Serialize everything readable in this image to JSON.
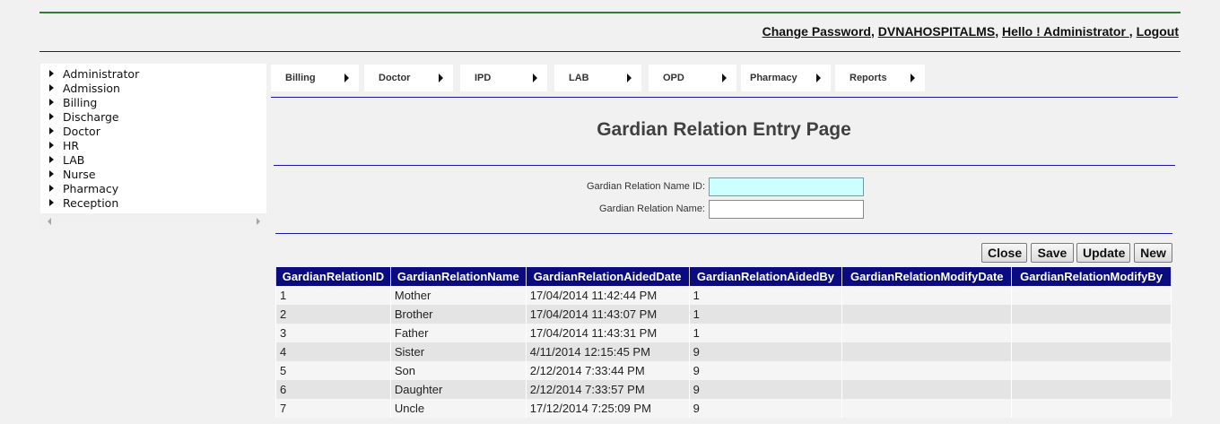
{
  "header": {
    "links": [
      {
        "label": "Change Password"
      },
      {
        "label": "DVNAHOSPITALMS"
      },
      {
        "label": "Hello ! Administrator "
      },
      {
        "label": "Logout"
      }
    ],
    "separator": ", "
  },
  "sidebar": {
    "items": [
      {
        "label": "Administrator"
      },
      {
        "label": "Admission"
      },
      {
        "label": "Billing"
      },
      {
        "label": "Discharge"
      },
      {
        "label": "Doctor"
      },
      {
        "label": "HR"
      },
      {
        "label": "LAB"
      },
      {
        "label": "Nurse"
      },
      {
        "label": "Pharmacy"
      },
      {
        "label": "Reception"
      }
    ]
  },
  "menu": {
    "items": [
      {
        "label": "Billing"
      },
      {
        "label": "Doctor"
      },
      {
        "label": "IPD"
      },
      {
        "label": "LAB"
      },
      {
        "label": "OPD"
      },
      {
        "label": "Pharmacy"
      },
      {
        "label": "Reports"
      }
    ]
  },
  "page": {
    "title": "Gardian Relation Entry Page"
  },
  "form": {
    "id_label": "Gardian Relation Name ID:",
    "id_value": "",
    "name_label": "Gardian Relation Name:",
    "name_value": ""
  },
  "buttons": {
    "close": "Close",
    "save": "Save",
    "update": "Update",
    "new": "New"
  },
  "table": {
    "columns": [
      "GardianRelationID",
      "GardianRelationName",
      "GardianRelationAidedDate",
      "GardianRelationAidedBy",
      "GardianRelationModifyDate",
      "GardianRelationModifyBy"
    ],
    "rows": [
      [
        "1",
        "Mother",
        "17/04/2014 11:42:44 PM",
        "1",
        "",
        ""
      ],
      [
        "2",
        "Brother",
        "17/04/2014 11:43:07 PM",
        "1",
        "",
        ""
      ],
      [
        "3",
        "Father",
        "17/04/2014 11:43:31 PM",
        "1",
        "",
        ""
      ],
      [
        "4",
        "Sister",
        "4/11/2014 12:15:45 PM",
        "9",
        "",
        ""
      ],
      [
        "5",
        "Son",
        "2/12/2014 7:33:44 PM",
        "9",
        "",
        ""
      ],
      [
        "6",
        "Daughter",
        "2/12/2014 7:33:57 PM",
        "9",
        "",
        ""
      ],
      [
        "7",
        "Uncle",
        "17/12/2014 7:25:09 PM",
        "9",
        "",
        ""
      ]
    ]
  },
  "colors": {
    "header_bg": "#0b0b80",
    "rule_blue": "#1a1aa0",
    "rule_green": "#2e7d32",
    "focus_field": "#ccffff"
  }
}
